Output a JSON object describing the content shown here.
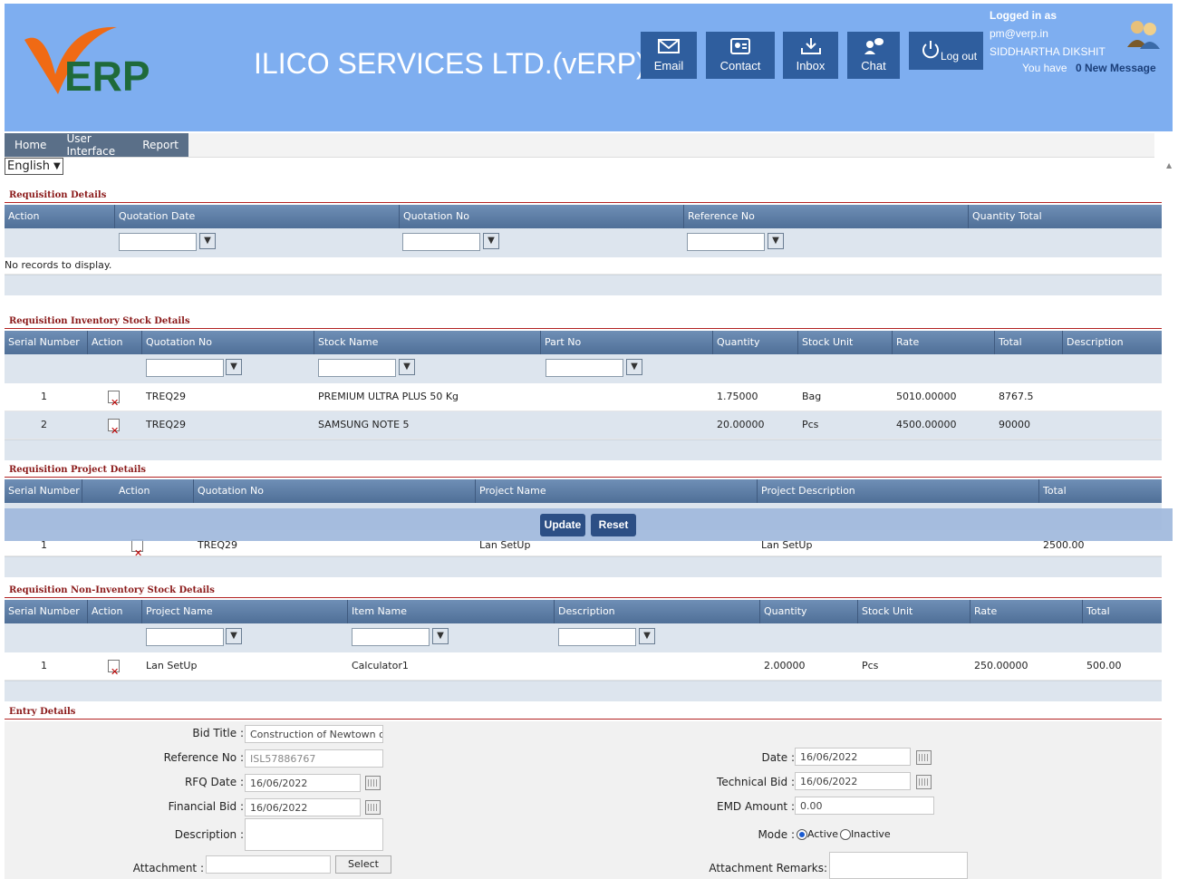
{
  "header": {
    "company": "ILICO SERVICES LTD.(vERP)",
    "logo_text": "ERP",
    "buttons": {
      "email": "Email",
      "contact": "Contact",
      "inbox": "Inbox",
      "chat": "Chat",
      "logout": "Log out"
    },
    "logged_in_label": "Logged in as",
    "email": "pm@verp.in",
    "user_name": "SIDDHARTHA DIKSHIT",
    "you_have": "You have",
    "messages": "0 New Message"
  },
  "menu": {
    "items": [
      "Home",
      "User Interface",
      "Report"
    ]
  },
  "language": {
    "selected": "English"
  },
  "requisition_details": {
    "title": "Requisition Details",
    "columns": [
      "Action",
      "Quotation Date",
      "Quotation No",
      "Reference No",
      "Quantity Total"
    ],
    "empty_text": "No records to display."
  },
  "inventory": {
    "title": "Requisition Inventory Stock Details",
    "columns": [
      "Serial Number",
      "Action",
      "Quotation No",
      "Stock Name",
      "Part No",
      "Quantity",
      "Stock Unit",
      "Rate",
      "Total",
      "Description"
    ],
    "rows": [
      {
        "serial": "1",
        "quotation_no": "TREQ29",
        "stock_name": "PREMIUM ULTRA PLUS 50 Kg",
        "part_no": "",
        "quantity": "1.75000",
        "unit": "Bag",
        "rate": "5010.00000",
        "total": "8767.5",
        "description": ""
      },
      {
        "serial": "2",
        "quotation_no": "TREQ29",
        "stock_name": "SAMSUNG NOTE 5",
        "part_no": "",
        "quantity": "20.00000",
        "unit": "Pcs",
        "rate": "4500.00000",
        "total": "90000",
        "description": ""
      }
    ]
  },
  "project": {
    "title": "Requisition Project Details",
    "columns": [
      "Serial Number",
      "Action",
      "Quotation No",
      "Project Name",
      "Project Description",
      "Total"
    ],
    "rows": [
      {
        "serial": "1",
        "quotation_no": "TREQ29",
        "project_name": "Lan SetUp",
        "project_description": "Lan SetUp",
        "total": "2500.00"
      }
    ]
  },
  "overlay": {
    "update": "Update",
    "reset": "Reset"
  },
  "non_inventory": {
    "title": "Requisition Non-Inventory Stock Details",
    "columns": [
      "Serial Number",
      "Action",
      "Project Name",
      "Item Name",
      "Description",
      "Quantity",
      "Stock Unit",
      "Rate",
      "Total"
    ],
    "rows": [
      {
        "serial": "1",
        "project_name": "Lan SetUp",
        "item_name": "Calculator1",
        "description": "",
        "quantity": "2.00000",
        "unit": "Pcs",
        "rate": "250.00000",
        "total": "500.00"
      }
    ]
  },
  "entry": {
    "title": "Entry Details",
    "labels": {
      "bid_title": "Bid Title :",
      "reference_no": "Reference No :",
      "rfq_date": "RFQ Date :",
      "financial_bid": "Financial Bid :",
      "description": "Description :",
      "attachment": "Attachment :",
      "date": "Date :",
      "technical_bid": "Technical Bid :",
      "emd_amount": "EMD Amount :",
      "mode": "Mode :",
      "attachment_remarks": "Attachment Remarks:"
    },
    "values": {
      "bid_title": "Construction of Newtown o",
      "reference_no": "ISL57886767",
      "rfq_date": "16/06/2022",
      "financial_bid": "16/06/2022",
      "date": "16/06/2022",
      "technical_bid": "16/06/2022",
      "emd_amount": "0.00"
    },
    "mode_options": {
      "active": "Active",
      "inactive": "Inactive",
      "selected": "Active"
    },
    "select_label": "Select"
  },
  "colors": {
    "header_bg": "#7eaef0",
    "grid_head": "#5a79a2",
    "section_title": "#8b1a1a",
    "button_dark": "#2c4f85"
  }
}
